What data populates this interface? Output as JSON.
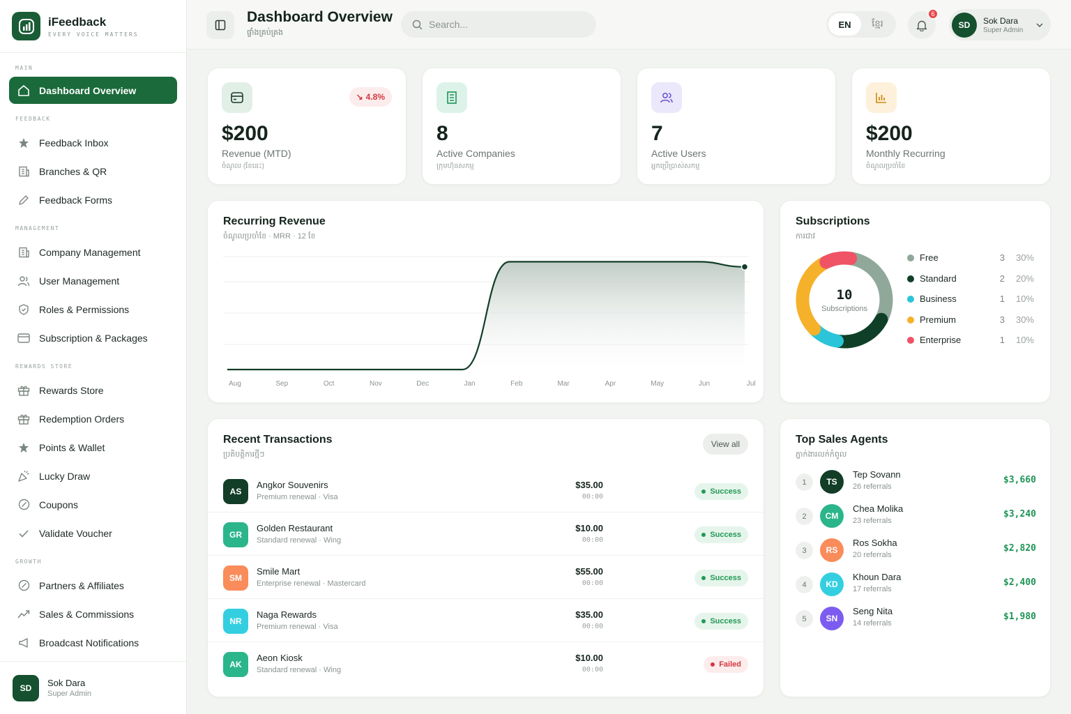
{
  "brand": {
    "name": "iFeedback",
    "tagline": "EVERY VOICE MATTERS"
  },
  "sidebar": {
    "sections": {
      "main": "MAIN",
      "feedback": "FEEDBACK",
      "management": "MANAGEMENT",
      "rewards": "REWARDS STORE",
      "growth": "GROWTH"
    },
    "items": {
      "dashboard": "Dashboard Overview",
      "inbox": "Feedback Inbox",
      "branches": "Branches & QR",
      "forms": "Feedback Forms",
      "company": "Company Management",
      "users": "User Management",
      "roles": "Roles & Permissions",
      "subs": "Subscription & Packages",
      "rewards": "Rewards Store",
      "redemption": "Redemption Orders",
      "points": "Points & Wallet",
      "lucky": "Lucky Draw",
      "coupons": "Coupons",
      "voucher": "Validate Voucher",
      "partners": "Partners & Affiliates",
      "sales": "Sales & Commissions",
      "broadcast": "Broadcast Notifications"
    },
    "user": {
      "initials": "SD",
      "name": "Sok Dara",
      "role": "Super Admin"
    }
  },
  "header": {
    "title": "Dashboard Overview",
    "subtitle": "ផ្ទាំងគ្រប់គ្រង",
    "search_placeholder": "Search...",
    "lang_en": "EN",
    "lang_kh": "ខ្មែរ",
    "notifications": "6",
    "user": {
      "initials": "SD",
      "name": "Sok Dara",
      "role": "Super Admin"
    }
  },
  "stats": [
    {
      "value": "$200",
      "label": "Revenue (MTD)",
      "kh": "ចំណូល (ខែនេះ)",
      "trend": "4.8%"
    },
    {
      "value": "8",
      "label": "Active Companies",
      "kh": "ក្រុមហ៊ុនសកម្ម"
    },
    {
      "value": "7",
      "label": "Active Users",
      "kh": "អ្នកប្រើប្រាស់សកម្ម"
    },
    {
      "value": "$200",
      "label": "Monthly Recurring",
      "kh": "ចំណូលប្រចាំខែ"
    }
  ],
  "revenue": {
    "title": "Recurring Revenue",
    "subtitle": "ចំណូលប្រចាំខែ · MRR · 12 ខែ"
  },
  "chart_data": {
    "type": "area",
    "title": "Recurring Revenue",
    "categories": [
      "Aug",
      "Sep",
      "Oct",
      "Nov",
      "Dec",
      "Jan",
      "Feb",
      "Mar",
      "Apr",
      "May",
      "Jun",
      "Jul"
    ],
    "values": [
      0,
      0,
      0,
      0,
      0,
      0,
      210,
      210,
      210,
      210,
      210,
      200
    ],
    "ylim": [
      0,
      220
    ],
    "grid": true
  },
  "subscriptions": {
    "title": "Subscriptions",
    "subtitle": "ការជាវ",
    "total": "10",
    "total_label": "Subscriptions",
    "items": [
      {
        "name": "Free",
        "count": "3",
        "pct": "30%",
        "value": 3,
        "color": "#8fa89a"
      },
      {
        "name": "Standard",
        "count": "2",
        "pct": "20%",
        "value": 2,
        "color": "#103f28"
      },
      {
        "name": "Business",
        "count": "1",
        "pct": "10%",
        "value": 1,
        "color": "#2cc4d8"
      },
      {
        "name": "Premium",
        "count": "3",
        "pct": "30%",
        "value": 3,
        "color": "#f5b12a"
      },
      {
        "name": "Enterprise",
        "count": "1",
        "pct": "10%",
        "value": 1,
        "color": "#ef5365"
      }
    ]
  },
  "transactions": {
    "title": "Recent Transactions",
    "subtitle": "ប្រតិបត្តិការថ្មីៗ",
    "view_all": "View all",
    "rows": [
      {
        "initials": "AS",
        "color": "#123d27",
        "name": "Angkor Souvenirs",
        "desc": "Premium renewal · Visa",
        "amount": "$35.00",
        "time": "00:00",
        "status": "Success"
      },
      {
        "initials": "GR",
        "color": "#2bb58a",
        "name": "Golden Restaurant",
        "desc": "Standard renewal · Wing",
        "amount": "$10.00",
        "time": "00:00",
        "status": "Success"
      },
      {
        "initials": "SM",
        "color": "#f98c5a",
        "name": "Smile Mart",
        "desc": "Enterprise renewal · Mastercard",
        "amount": "$55.00",
        "time": "00:00",
        "status": "Success"
      },
      {
        "initials": "NR",
        "color": "#33cfe0",
        "name": "Naga Rewards",
        "desc": "Premium renewal · Visa",
        "amount": "$35.00",
        "time": "00:00",
        "status": "Success"
      },
      {
        "initials": "AK",
        "color": "#2bb58a",
        "name": "Aeon Kiosk",
        "desc": "Standard renewal · Wing",
        "amount": "$10.00",
        "time": "00:00",
        "status": "Failed"
      }
    ]
  },
  "agents": {
    "title": "Top Sales Agents",
    "subtitle": "ភ្នាក់ងារលក់កំពូល",
    "rows": [
      {
        "rank": "1",
        "initials": "TS",
        "color": "#123d27",
        "name": "Tep Sovann",
        "refs": "26 referrals",
        "amount": "$3,660"
      },
      {
        "rank": "2",
        "initials": "CM",
        "color": "#2bb58a",
        "name": "Chea Molika",
        "refs": "23 referrals",
        "amount": "$3,240"
      },
      {
        "rank": "3",
        "initials": "RS",
        "color": "#f98c5a",
        "name": "Ros Sokha",
        "refs": "20 referrals",
        "amount": "$2,820"
      },
      {
        "rank": "4",
        "initials": "KD",
        "color": "#33cfe0",
        "name": "Khoun Dara",
        "refs": "17 referrals",
        "amount": "$2,400"
      },
      {
        "rank": "5",
        "initials": "SN",
        "color": "#7c5cf0",
        "name": "Seng Nita",
        "refs": "14 referrals",
        "amount": "$1,980"
      }
    ]
  }
}
